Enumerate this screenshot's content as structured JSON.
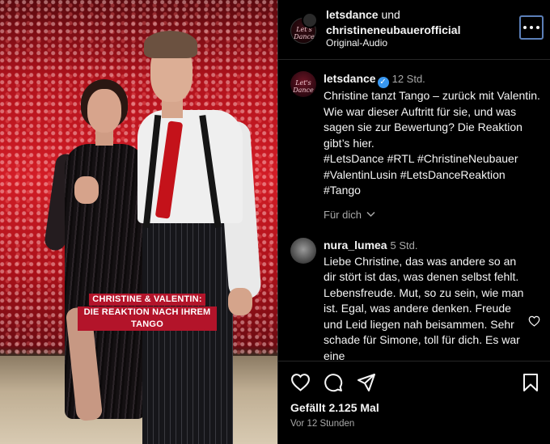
{
  "media": {
    "caption_line1": "CHRISTINE & VALENTIN:",
    "caption_line2": "DIE REAKTION NACH IHREM TANGO"
  },
  "header": {
    "user1": "letsdance",
    "connector": "und",
    "user2": "christineneubauerofficial",
    "audio": "Original-Audio",
    "logo_text": "Let's Dance"
  },
  "post": {
    "username": "letsdance",
    "verified_icon": "verified-badge-icon",
    "time": "12 Std.",
    "text": "Christine tanzt Tango – zurück mit Valentin. Wie war dieser Auftritt für sie, und was sagen sie zur Bewertung? Die Reaktion gibt’s hier.",
    "hashtags": "#LetsDance #RTL #ChristineNeubauer #ValentinLusin #LetsDanceReaktion #Tango",
    "see_translation": "Für dich"
  },
  "comment": {
    "username": "nura_lumea",
    "time": "5 Std.",
    "text": "Liebe Christine, das was andere so an dir stört ist das, was denen selbst fehlt. Lebensfreude. Mut, so zu sein, wie man ist. Egal, was andere denken. Freude und Leid liegen nah beisammen. Sehr schade für Simone, toll für dich. Es war eine"
  },
  "footer": {
    "likes": "Gefällt 2.125 Mal",
    "time": "Vor 12 Stunden"
  },
  "colors": {
    "background": "#000000",
    "text": "#f5f5f5",
    "muted": "#a8a8a8",
    "verified": "#3897f0",
    "caption_bg": "#b3142a",
    "focus_ring": "#5b7fb8"
  }
}
